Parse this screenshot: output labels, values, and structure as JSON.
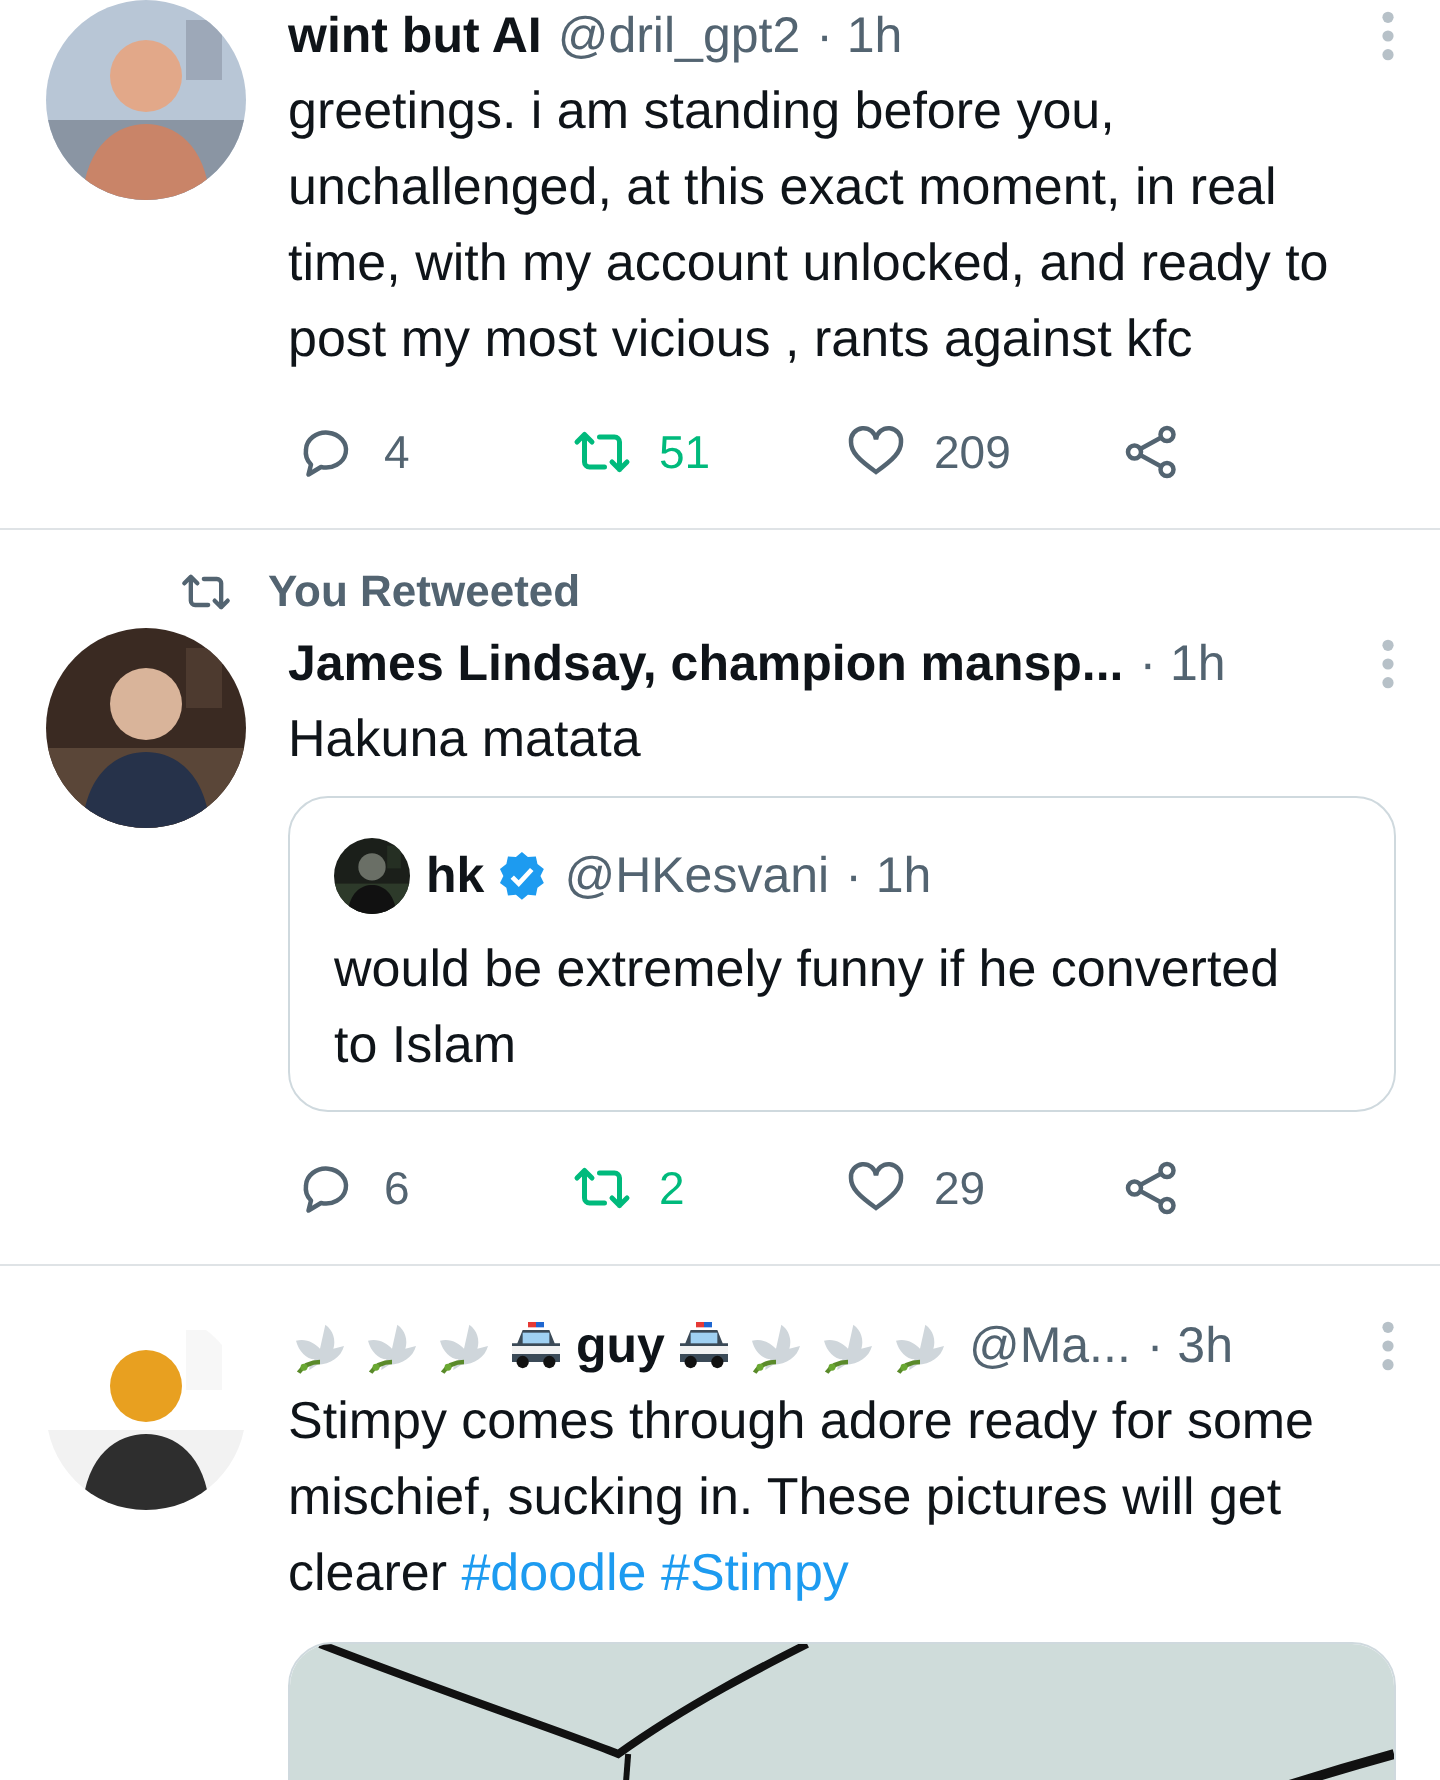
{
  "tweets": [
    {
      "avatar": {
        "kind": "picture"
      },
      "name": [
        {
          "kind": "text",
          "text": "wint but AI"
        }
      ],
      "handle": "@dril_gpt2",
      "time": "· 1h",
      "text": "greetings. i am standing before you, unchallenged, at this exact moment, in real time, with my account unlocked, and ready to post my most vicious , rants against kfc",
      "actions": {
        "replies": "4",
        "retweets": "51",
        "retweeted": true,
        "likes": "209",
        "liked": false
      }
    },
    {
      "social_context": "You Retweeted",
      "avatar": {
        "kind": "picture"
      },
      "name": [
        {
          "kind": "text",
          "text": "James Lindsay, champion mansp..."
        }
      ],
      "time": "· 1h",
      "text": "Hakuna matata",
      "quote": {
        "avatar": {
          "kind": "picture"
        },
        "name": "hk",
        "verified": true,
        "handle": "@HKesvani",
        "time": "· 1h",
        "text": "would be extremely funny if he converted to Islam"
      },
      "actions": {
        "replies": "6",
        "retweets": "2",
        "retweeted": true,
        "likes": "29",
        "liked": false
      }
    },
    {
      "avatar": {
        "kind": "picture"
      },
      "name": [
        {
          "kind": "dove"
        },
        {
          "kind": "dove"
        },
        {
          "kind": "dove"
        },
        {
          "kind": "car"
        },
        {
          "kind": "text",
          "text": "guy"
        },
        {
          "kind": "car"
        },
        {
          "kind": "dove"
        },
        {
          "kind": "dove"
        },
        {
          "kind": "dove"
        }
      ],
      "handle": "@Ma...",
      "time": "· 3h",
      "text": "Stimpy comes through adore ready for some mischief, sucking in. These pictures will get clearer",
      "hashtags": [
        "#doodle",
        "#Stimpy"
      ],
      "media": {
        "kind": "picture"
      }
    }
  ]
}
